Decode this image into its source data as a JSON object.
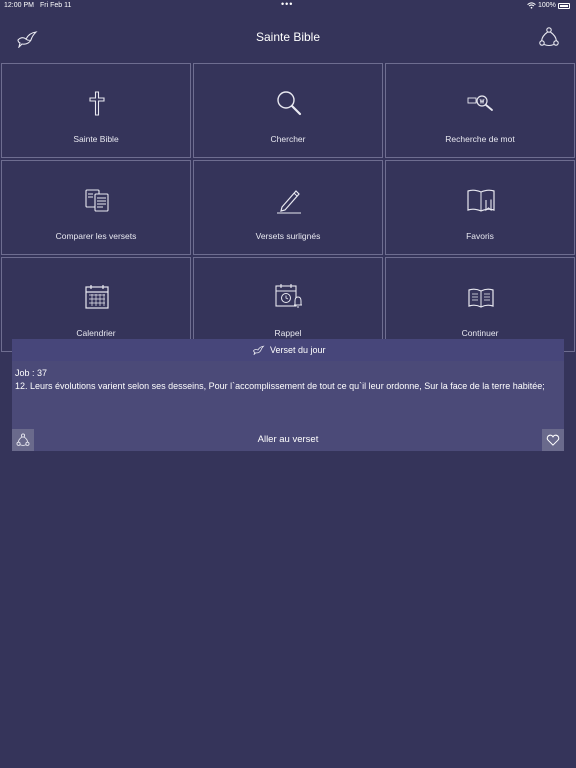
{
  "status": {
    "time": "12:00 PM",
    "date": "Fri Feb 11",
    "battery": "100%"
  },
  "header": {
    "title": "Sainte Bible",
    "logo_icon": "dove-icon",
    "share_icon": "share-icon"
  },
  "tiles": [
    {
      "label": "Sainte Bible",
      "icon": "cross-icon"
    },
    {
      "label": "Chercher",
      "icon": "magnifier-icon"
    },
    {
      "label": "Recherche de mot",
      "icon": "word-search-icon"
    },
    {
      "label": "Comparer les versets",
      "icon": "compare-icon"
    },
    {
      "label": "Versets surlignés",
      "icon": "pencil-icon"
    },
    {
      "label": "Favoris",
      "icon": "bookmark-book-icon"
    },
    {
      "label": "Calendrier",
      "icon": "calendar-icon"
    },
    {
      "label": "Rappel",
      "icon": "reminder-icon"
    },
    {
      "label": "Continuer",
      "icon": "open-book-icon"
    }
  ],
  "verse_of_day": {
    "title": "Verset du jour",
    "reference": "Job : 37",
    "text": "12. Leurs évolutions varient selon ses desseins, Pour l`accomplissement de tout ce qu`il leur ordonne, Sur la face de la terre habitée;",
    "go_label": "Aller au verset"
  },
  "colors": {
    "background": "#35345a",
    "tile_border": "#6e6d90",
    "card": "#4b4a78"
  }
}
